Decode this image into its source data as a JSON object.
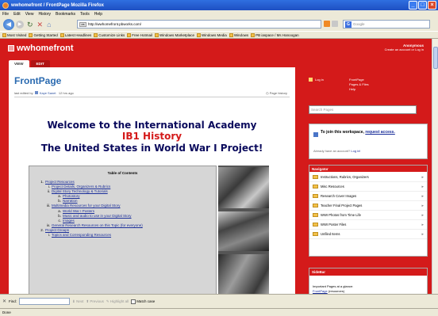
{
  "window": {
    "title": "wwhomefront / FrontPage  Mozilla Firefox"
  },
  "menu": [
    "File",
    "Edit",
    "View",
    "History",
    "Bookmarks",
    "Tools",
    "Help"
  ],
  "address": {
    "favicon_label": "PB",
    "url": "http://wwhomefront.pbworks.com/"
  },
  "searchbar": {
    "engine": "G",
    "placeholder": "Google"
  },
  "bookmarks": [
    "Most Visited",
    "Getting Started",
    "Latest Headlines",
    "Customize Links",
    "Free Hotmail",
    "Windows Marketplace",
    "Windows Media",
    "Windows",
    "PB iaspace / Ms Hanoogan"
  ],
  "site": {
    "name": "wwhomefront",
    "account_name": "Anonymous",
    "account_link": "Create an account or Log in"
  },
  "tabs": {
    "view": "VIEW",
    "edit": "EDIT"
  },
  "page": {
    "title": "FrontPage",
    "edited_by_prefix": "last edited by",
    "editor": "Kaye Sanet",
    "edited_when": "12 hrs ago",
    "history_link": "Page history",
    "welcome_line1": "Welcome to the International Academy",
    "welcome_line2": "IB1 History",
    "welcome_line3": "The United States in World War I Project!"
  },
  "toc": {
    "title": "Table of Contents",
    "items": [
      {
        "num": "1.",
        "text": "Project Resources",
        "level": 1
      },
      {
        "num": "i.",
        "text": "Project Details, Organizers & Rubrics",
        "level": 2
      },
      {
        "num": "ii.",
        "text": "Digital Story Technology & Tutorials",
        "level": 2
      },
      {
        "num": "a.",
        "text": "Photostory",
        "level": 3
      },
      {
        "num": "b.",
        "text": "Narration",
        "level": 3
      },
      {
        "num": "iii.",
        "text": "Multimedia Resources for your Digital Story",
        "level": 2
      },
      {
        "num": "a.",
        "text": "World War I Posters",
        "level": 3
      },
      {
        "num": "b.",
        "text": "Music and audio to use in your Digital Story",
        "level": 3
      },
      {
        "num": "c.",
        "text": "Images",
        "level": 3
      },
      {
        "num": "iv.",
        "text": "General Research Resources on this Topic (for everyone)",
        "level": 2
      },
      {
        "num": "2.",
        "text": "Project Groups",
        "level": 1
      },
      {
        "num": "i.",
        "text": "Topics and Corresponding Resources",
        "level": 2
      }
    ]
  },
  "sidebar": {
    "login_label": "Log in",
    "side_links": [
      "FrontPage",
      "Pages & Files",
      "Help"
    ],
    "search_placeholder": "Search Pages",
    "join_text_prefix": "To join this workspace,",
    "join_link": "request access.",
    "already_text": "Already have an account?",
    "login_link": "Log in!",
    "navigator_title": "Navigator",
    "nav_items": [
      "Instructions, Rubrics, Organizers",
      "Misc Resources",
      "Research Cover Images",
      "Teacher Final Project Pages",
      "WWI Photos from Time Life",
      "WWI Poster Files",
      "Unfiled Items"
    ],
    "sidebar_title": "SideBar",
    "sidebar_text": "Important Pages at a glance:",
    "sidebar_link": "FrontPage",
    "sidebar_link_suffix": "(resources)"
  },
  "findbar": {
    "label": "Find:",
    "next": "Next",
    "previous": "Previous",
    "highlight": "Highlight all",
    "match_case": "Match case"
  },
  "status": "Done"
}
